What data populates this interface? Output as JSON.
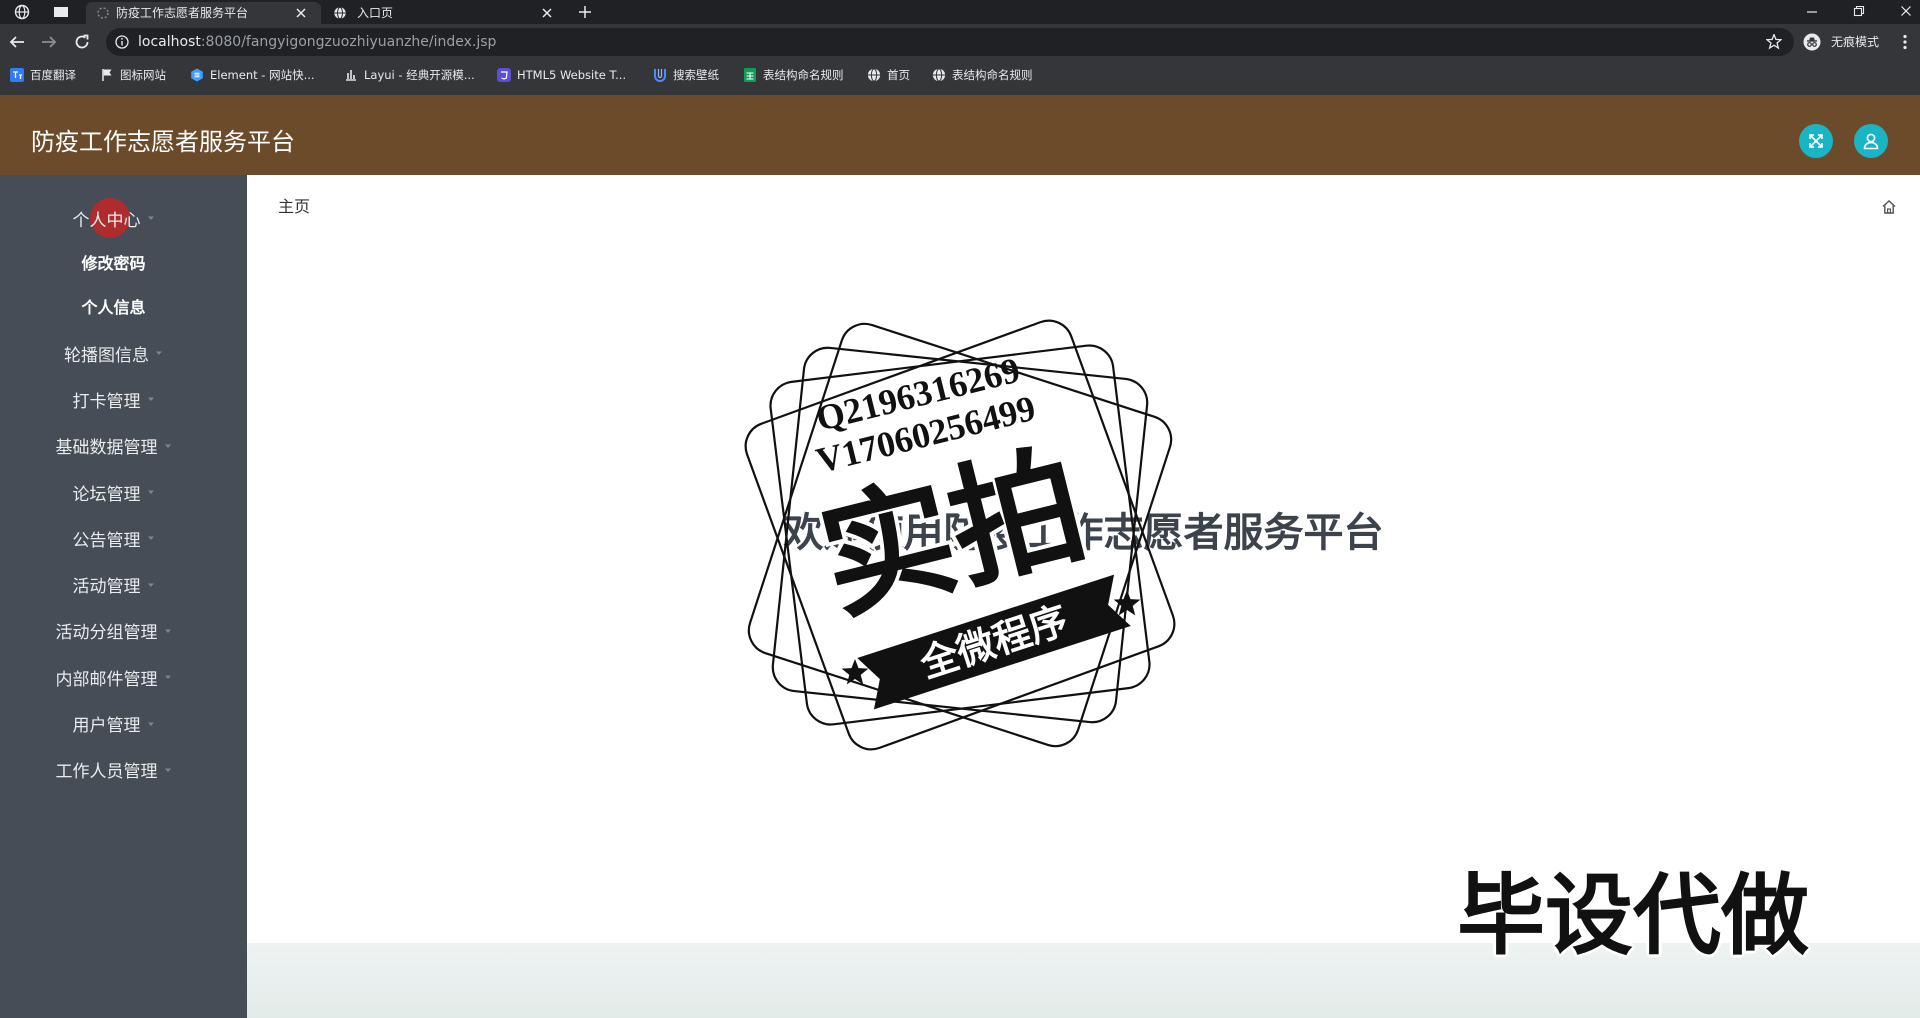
{
  "browser": {
    "tabs": [
      {
        "title": "防疫工作志愿者服务平台",
        "icon": "page-icon"
      },
      {
        "title": "入口页",
        "icon": "globe-icon"
      }
    ],
    "url_host": "localhost",
    "url_path": ":8080/fangyigongzuozhiyuanzhe/index.jsp",
    "incognito_label": "无痕模式",
    "bookmarks": [
      {
        "label": "百度翻译",
        "icon": "translate-icon"
      },
      {
        "label": "图标网站",
        "icon": "flag-icon"
      },
      {
        "label": "Element - 网站快...",
        "icon": "element-icon"
      },
      {
        "label": "Layui - 经典开源模...",
        "icon": "layui-icon"
      },
      {
        "label": "HTML5 Website T...",
        "icon": "html5-icon"
      },
      {
        "label": "搜索壁纸",
        "icon": "wallpaper-icon"
      },
      {
        "label": "表结构命名规则",
        "icon": "sheet-icon"
      },
      {
        "label": "首页",
        "icon": "globe-icon"
      },
      {
        "label": "表结构命名规则",
        "icon": "globe-icon"
      }
    ]
  },
  "header": {
    "title": "防疫工作志愿者服务平台",
    "icons": [
      "fullscreen-icon",
      "user-icon"
    ]
  },
  "colors": {
    "browser_dark": "#202124",
    "browser_bar": "#35363a",
    "header_bg": "#6c4b2b",
    "sidebar_bg": "#464d56",
    "accent": "#19b5c5",
    "welcome_text": "#3d434c"
  },
  "sidebar": {
    "items": [
      {
        "label": "个人中心",
        "children": [
          {
            "label": "修改密码"
          },
          {
            "label": "个人信息"
          }
        ]
      },
      {
        "label": "轮播图信息"
      },
      {
        "label": "打卡管理"
      },
      {
        "label": "基础数据管理"
      },
      {
        "label": "论坛管理"
      },
      {
        "label": "公告管理"
      },
      {
        "label": "活动管理"
      },
      {
        "label": "活动分组管理"
      },
      {
        "label": "内部邮件管理"
      },
      {
        "label": "用户管理"
      },
      {
        "label": "工作人员管理"
      }
    ]
  },
  "breadcrumb": {
    "label": "主页",
    "icon": "home-icon"
  },
  "main": {
    "welcome": "欢迎使用防疫工作志愿者服务平台"
  },
  "watermark": {
    "stamp_line1": "Q2196316269",
    "stamp_line2": "V17060256499",
    "stamp_title": "实拍",
    "stamp_banner": "全微程序",
    "corner_text": "毕设代做"
  }
}
